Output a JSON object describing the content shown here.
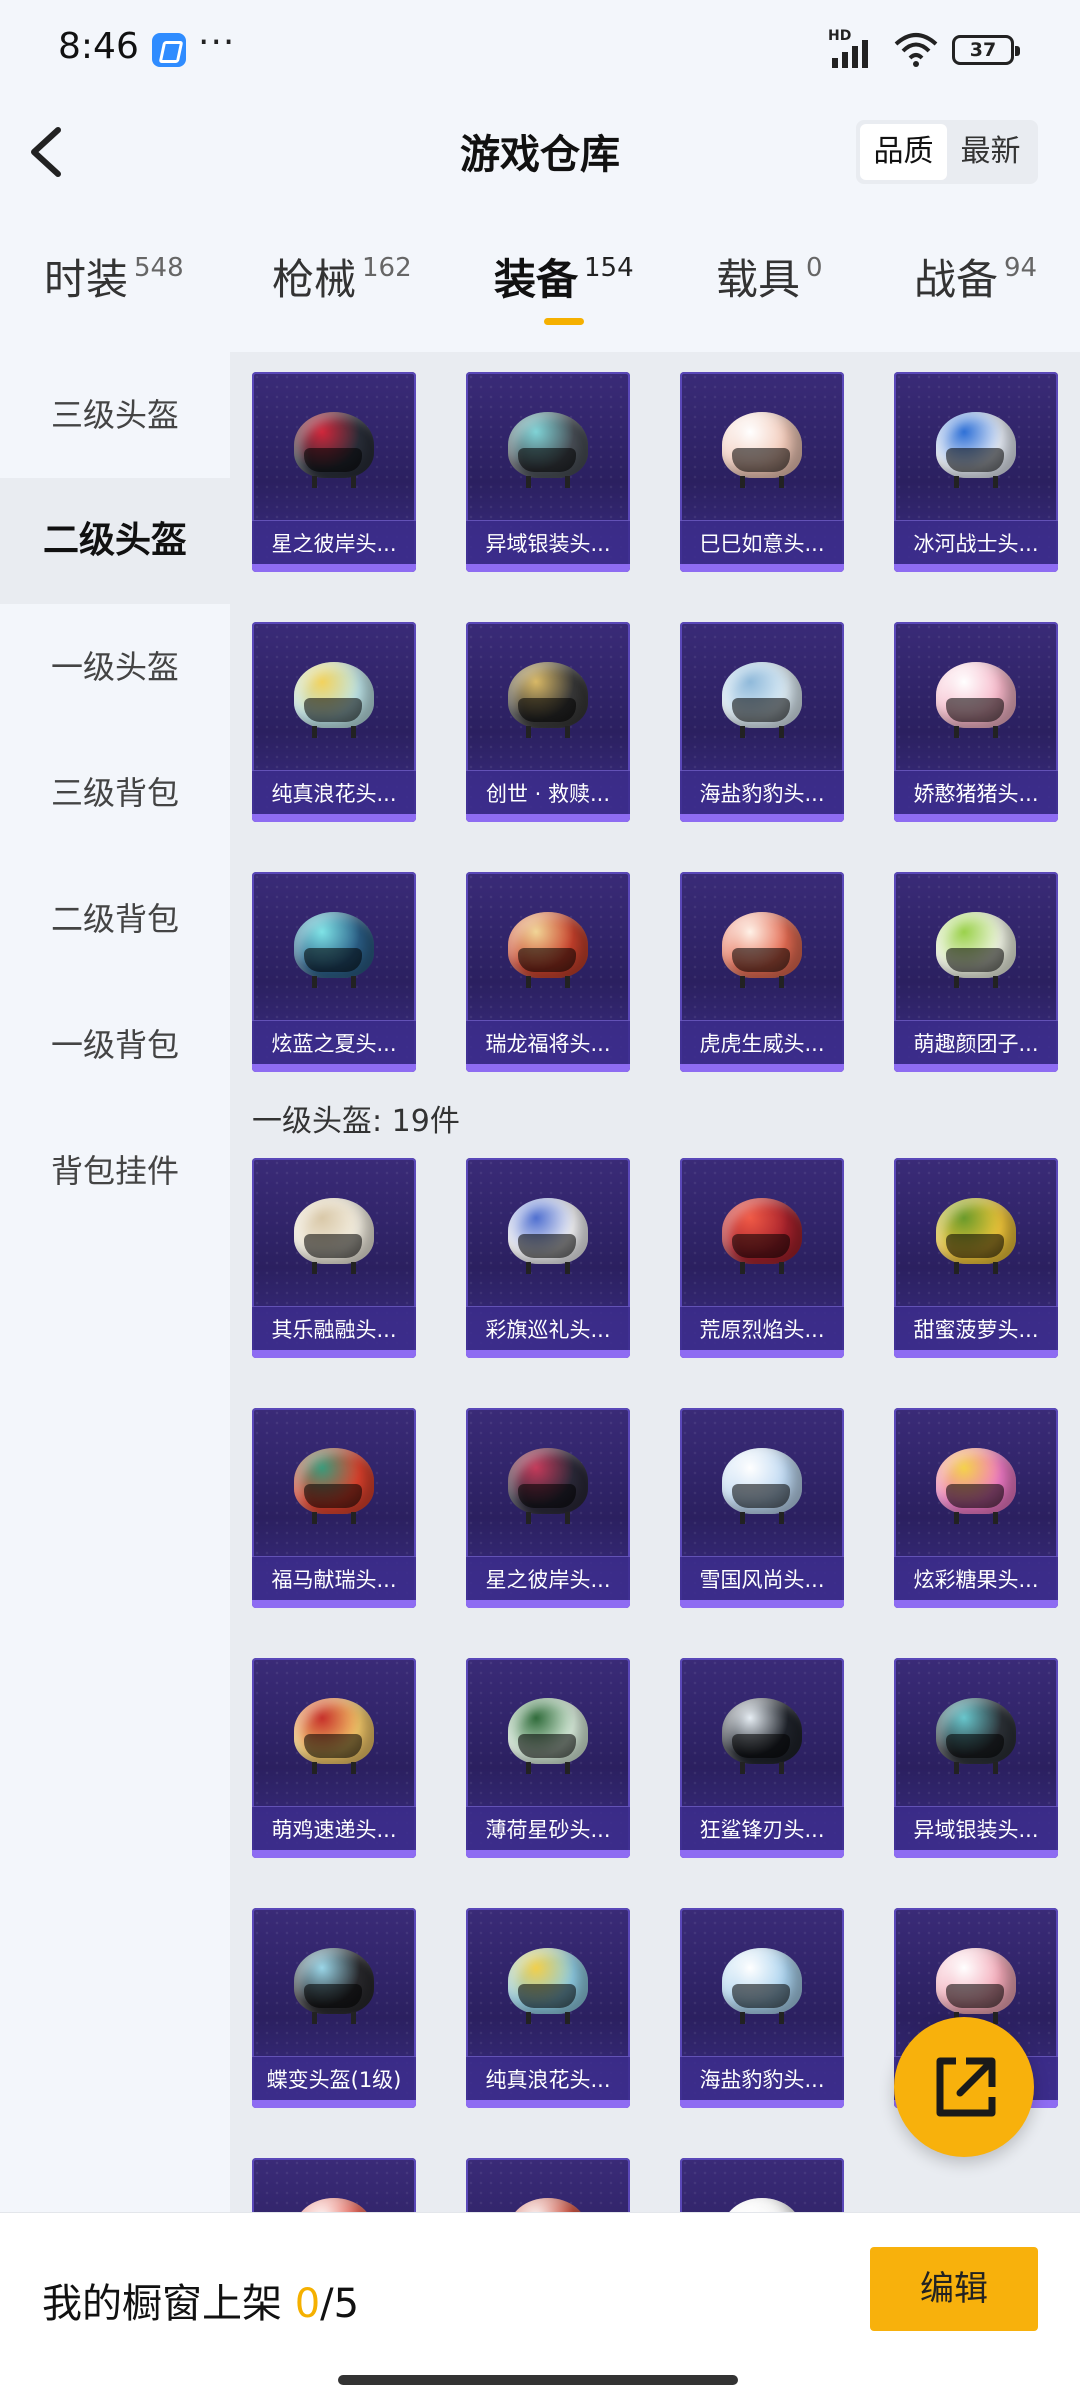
{
  "status_bar": {
    "time": "8:46",
    "more": "···",
    "network": "HD",
    "battery": "37"
  },
  "header": {
    "title": "游戏仓库",
    "sort_options": [
      {
        "label": "品质",
        "active": true
      },
      {
        "label": "最新",
        "active": false
      }
    ]
  },
  "category_tabs": [
    {
      "label": "时装",
      "count": "548",
      "active": false
    },
    {
      "label": "枪械",
      "count": "162",
      "active": false
    },
    {
      "label": "装备",
      "count": "154",
      "active": true
    },
    {
      "label": "载具",
      "count": "0",
      "active": false
    },
    {
      "label": "战备",
      "count": "94",
      "active": false
    }
  ],
  "sidebar": {
    "items": [
      {
        "label": "三级头盔",
        "active": false
      },
      {
        "label": "二级头盔",
        "active": true
      },
      {
        "label": "一级头盔",
        "active": false
      },
      {
        "label": "三级背包",
        "active": false
      },
      {
        "label": "二级背包",
        "active": false
      },
      {
        "label": "一级背包",
        "active": false
      },
      {
        "label": "背包挂件",
        "active": false
      }
    ]
  },
  "sections": [
    {
      "label": "",
      "items": [
        {
          "name": "星之彼岸头...",
          "color": "#2a2f3a",
          "accent": "#d0263a"
        },
        {
          "name": "异域银装头...",
          "color": "#4a5058",
          "accent": "#7fd3d6"
        },
        {
          "name": "巳巳如意头...",
          "color": "#f2c9b8",
          "accent": "#ffffff"
        },
        {
          "name": "冰河战士头...",
          "color": "#e8eef8",
          "accent": "#2d6fd6"
        },
        {
          "name": "纯真浪花头...",
          "color": "#bfe6ea",
          "accent": "#f2d25c"
        },
        {
          "name": "创世 · 救赎...",
          "color": "#3a3a3a",
          "accent": "#d8b865"
        },
        {
          "name": "海盐豹豹头...",
          "color": "#dfeef7",
          "accent": "#8fb9da"
        },
        {
          "name": "娇憨猪猪头...",
          "color": "#f6b6c8",
          "accent": "#ffffff"
        },
        {
          "name": "炫蓝之夏头...",
          "color": "#2b5f88",
          "accent": "#7ee3e6"
        },
        {
          "name": "瑞龙福将头...",
          "color": "#c8412c",
          "accent": "#f1d596"
        },
        {
          "name": "虎虎生威头...",
          "color": "#e46b52",
          "accent": "#fff2e8"
        },
        {
          "name": "萌趣颜团子...",
          "color": "#f2f6e6",
          "accent": "#9ad14a"
        }
      ]
    },
    {
      "label": "一级头盔: 19件",
      "items": [
        {
          "name": "其乐融融头...",
          "color": "#f4efe2",
          "accent": "#d9c8a8"
        },
        {
          "name": "彩旗巡礼头...",
          "color": "#f3f3f6",
          "accent": "#4f6fd0"
        },
        {
          "name": "荒原烈焰头...",
          "color": "#a8222c",
          "accent": "#f05a46"
        },
        {
          "name": "甜蜜菠萝头...",
          "color": "#f1c63a",
          "accent": "#6a9a2a"
        },
        {
          "name": "福马献瑞头...",
          "color": "#e0422d",
          "accent": "#3a9a7a"
        },
        {
          "name": "星之彼岸头...",
          "color": "#2c2a3a",
          "accent": "#c43a5a"
        },
        {
          "name": "雪国风尚头...",
          "color": "#bdd8f2",
          "accent": "#ffffff"
        },
        {
          "name": "炫彩糖果头...",
          "color": "#f07ac6",
          "accent": "#f4d24a"
        },
        {
          "name": "萌鸡速递头...",
          "color": "#f4c96a",
          "accent": "#c6302a"
        },
        {
          "name": "薄荷星砂头...",
          "color": "#d9eddc",
          "accent": "#2f6b3a"
        },
        {
          "name": "狂鲨锋刃头...",
          "color": "#20242c",
          "accent": "#e7eef4"
        },
        {
          "name": "异域银装头...",
          "color": "#2d3238",
          "accent": "#67c6cc"
        },
        {
          "name": "蝶变头盔(1级)",
          "color": "#2a2a2e",
          "accent": "#9ad6e8"
        },
        {
          "name": "纯真浪花头...",
          "color": "#8fcde4",
          "accent": "#f1cf4a"
        },
        {
          "name": "海盐豹豹头...",
          "color": "#a9d2ee",
          "accent": "#ffffff"
        },
        {
          "name": "",
          "color": "#f3a9b8",
          "accent": "#ffffff"
        },
        {
          "name": "",
          "color": "#e4584a",
          "accent": "#ffffff"
        },
        {
          "name": "",
          "color": "#c8422f",
          "accent": "#ffffff"
        },
        {
          "name": "",
          "color": "#f2f2f2",
          "accent": "#ffffff"
        }
      ]
    }
  ],
  "bottom_bar": {
    "label": "我的橱窗上架 ",
    "current": "0",
    "total": "/5",
    "edit_button": "编辑"
  }
}
